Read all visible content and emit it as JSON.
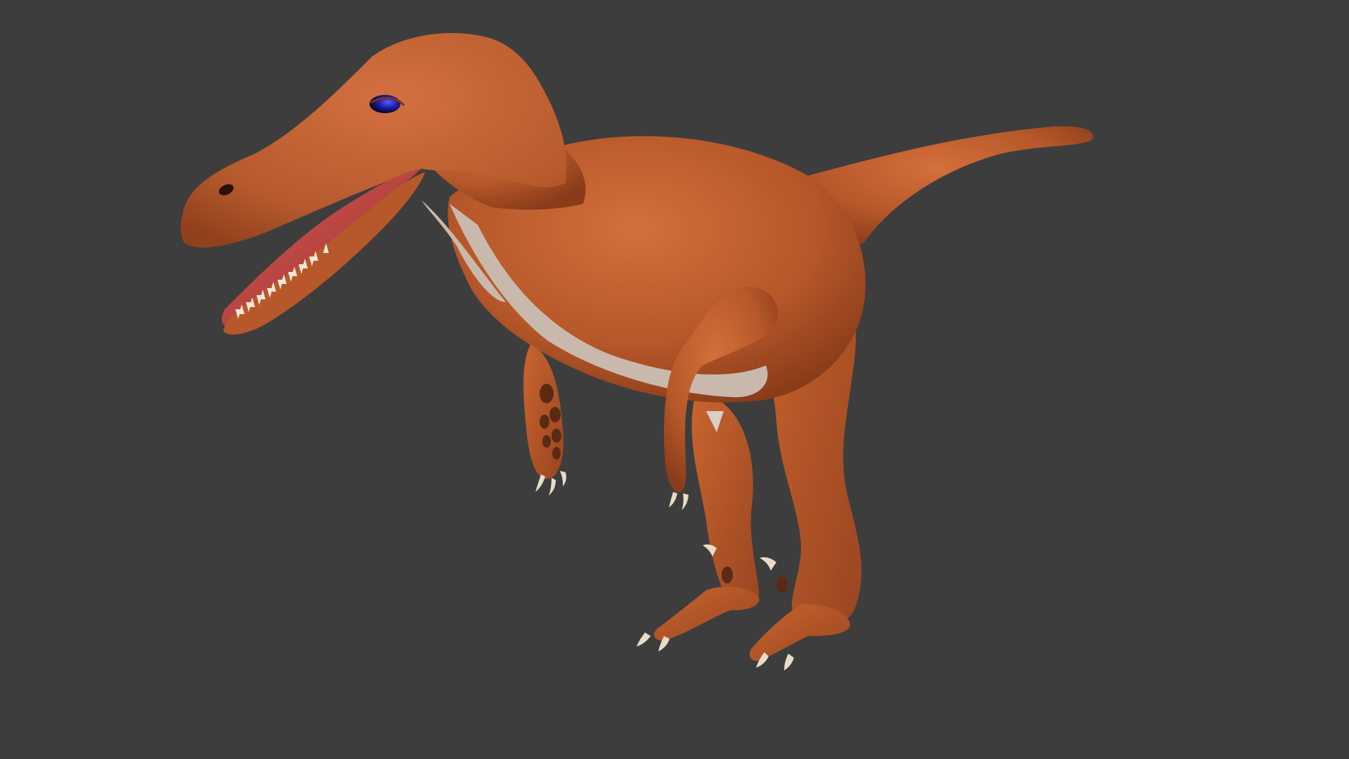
{
  "viewport": {
    "background_color": "#3d3d3d"
  },
  "render": {
    "subject": "raptor-dinosaur-model",
    "colors": {
      "skin": "#b7582a",
      "skin_light": "#cf7040",
      "skin_dark": "#8a3c1a",
      "belly": "#c9b9ac",
      "mouth": "#b2393a",
      "mouth_inner": "#d9574f",
      "teeth": "#efe6d6",
      "eye": "#1f1fa8",
      "claws": "#e7dcc6",
      "pads": "#5a2a14"
    }
  }
}
